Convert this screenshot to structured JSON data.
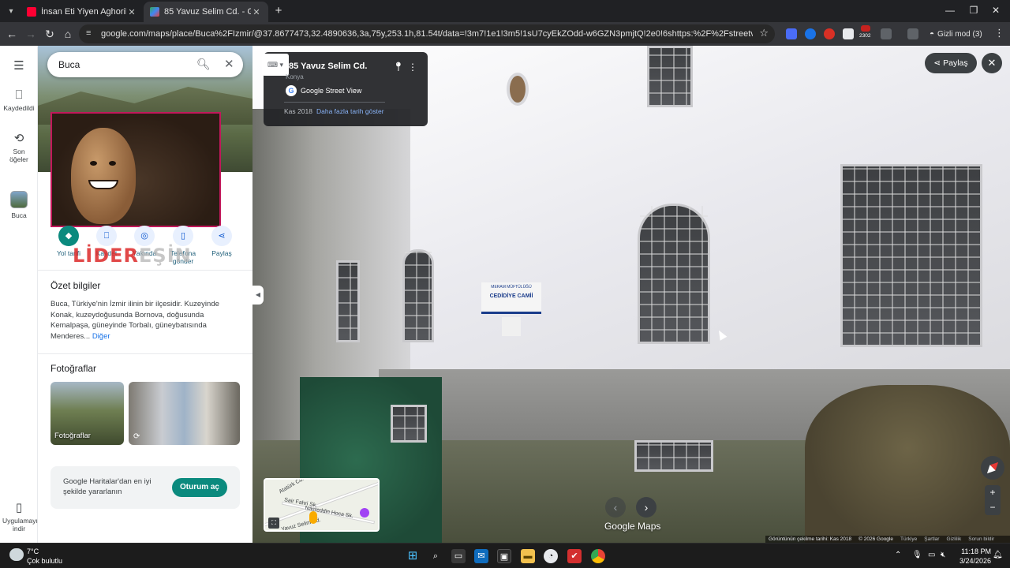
{
  "browser": {
    "tabs": [
      {
        "title": "İnsan Eti Yiyen Aghoriler | Ölüle",
        "favicon_color": "#ff0033"
      },
      {
        "title": "85 Yavuz Selim Cd. - Google Ha",
        "favicon_color": "#34a853"
      }
    ],
    "new_tab": "+",
    "url": "google.com/maps/place/Buca%2FIzmir/@37.8677473,32.4890636,3a,75y,253.1h,81.54t/data=!3m7!1e1!3m5!1sU7cyEkZOdd-w6GZN3pmjtQ!2e0!6shttps:%2F%2Fstreetviewpixels-pa.googleapis.com%2...",
    "extension_badge": "2302",
    "incognito_label": "Gizli mod (3)"
  },
  "sidebar": {
    "items": [
      {
        "label": "Kaydedildi",
        "icon": "bookmark-icon"
      },
      {
        "label": "Son öğeler",
        "icon": "history-icon"
      },
      {
        "label": "Buca",
        "icon": "thumbnail"
      },
      {
        "label": "Uygulamayı indir",
        "icon": "phone-icon"
      }
    ]
  },
  "search": {
    "query": "Buca"
  },
  "actions": [
    {
      "label": "Yol tarifi",
      "icon": "directions-icon"
    },
    {
      "label": "Kaydet",
      "icon": "bookmark-icon"
    },
    {
      "label": "Yakında",
      "icon": "nearby-icon"
    },
    {
      "label": "Telefona gönder",
      "icon": "send-to-phone-icon"
    },
    {
      "label": "Paylaş",
      "icon": "share-icon"
    }
  ],
  "watermark": {
    "part1": "LİDER",
    "part2": "EŞİN"
  },
  "overview": {
    "title": "Özet bilgiler",
    "text": "Buca, Türkiye'nin İzmir ilinin bir ilçesidir. Kuzeyinde Konak, kuzeydoğusunda Bornova, doğusunda Kemalpaşa, güneyinde Torbalı, güneybatısında Menderes...",
    "more": "Diğer"
  },
  "photos": {
    "title": "Fotoğraflar",
    "caption": "Fotoğraflar"
  },
  "signin": {
    "text": "Google Haritalar'dan en iyi şekilde yararlanın",
    "button": "Oturum aç"
  },
  "streetview": {
    "address": "85 Yavuz Selim Cd.",
    "city": "Konya",
    "provider": "Google Street View",
    "date": "Kas 2018",
    "history_link": "Daha fazla tarih göster",
    "share": "Paylaş",
    "sign_line1": "MERAM MÜFTÜLÜĞÜ",
    "sign_line2": "CEDİDİYE CAMİİ",
    "logo": "Google Maps",
    "minimap_labels": [
      "Atatürk Cd.",
      "Sair Fahri Sk.",
      "Nasreddin Hoca Sk.",
      "Yavuz Selim Cd."
    ],
    "footer": [
      "Görüntünün çekilme tarihi: Kas 2018",
      "© 2026 Google",
      "Türkiye",
      "Şartlar",
      "Gizlilik",
      "Sorun bildir"
    ]
  },
  "taskbar": {
    "temp": "7°C",
    "weather": "Çok bulutlu",
    "time": "11:18 PM",
    "date": "3/24/2026",
    "apps": [
      "start-icon",
      "search-icon",
      "task-view-icon",
      "outlook-icon",
      "store-icon",
      "file-explorer-icon",
      "app-icon",
      "app-red-icon",
      "chrome-icon"
    ]
  },
  "colors": {
    "maps_teal": "#0b8a7e",
    "link_blue": "#1a73e8",
    "chrome_dark": "#202124"
  }
}
